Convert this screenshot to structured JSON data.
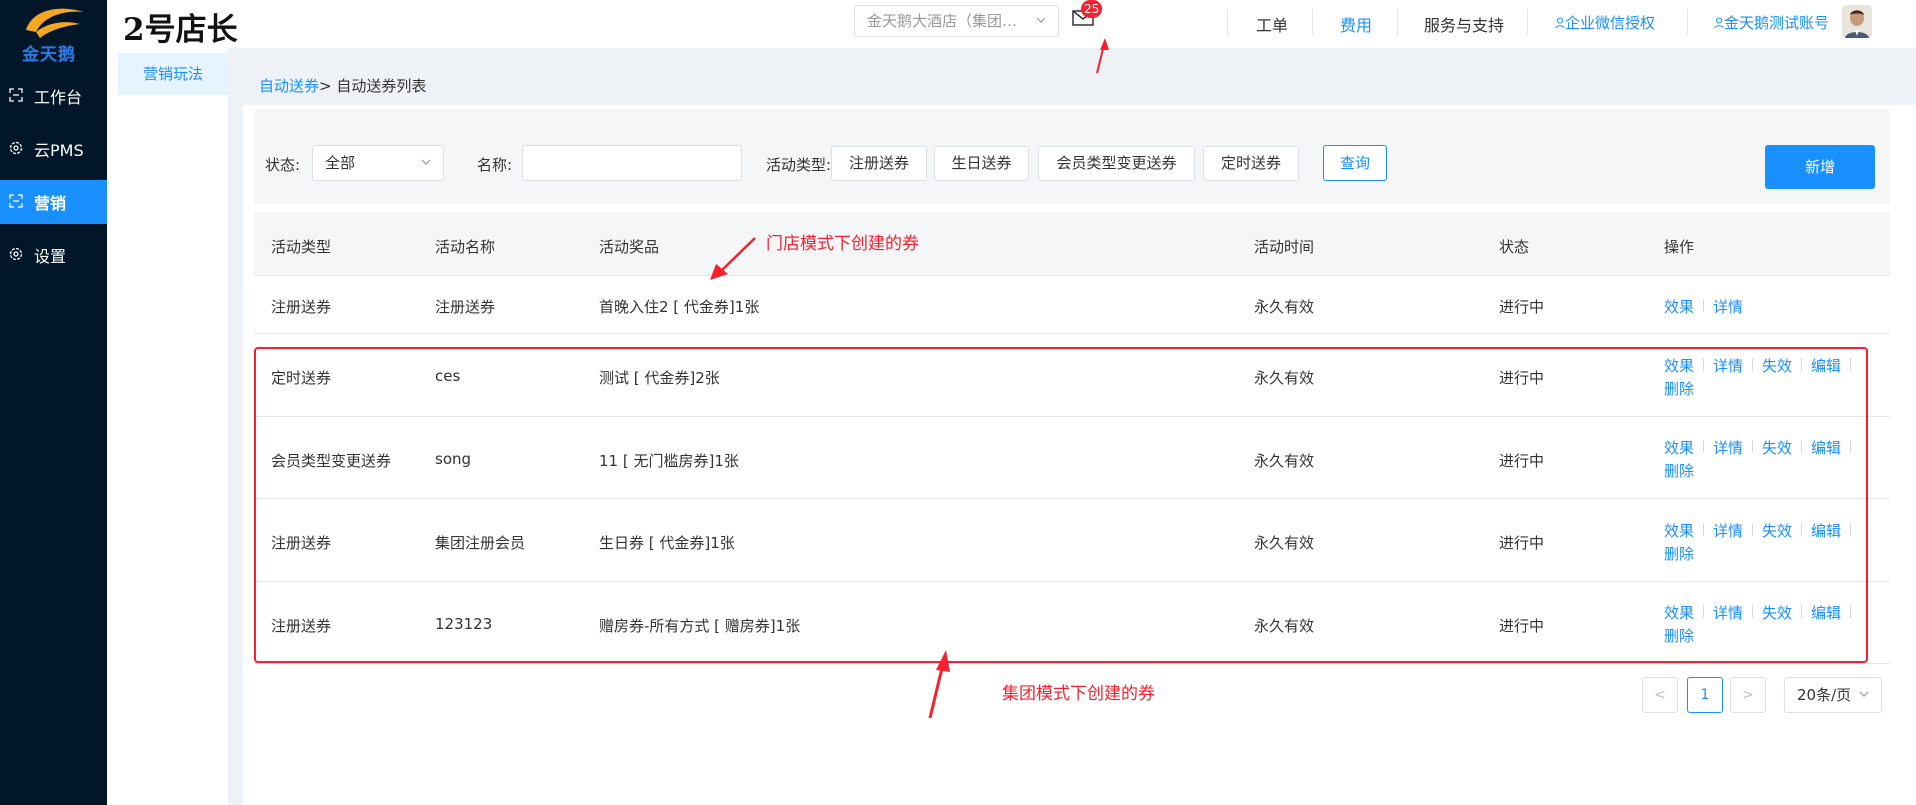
{
  "brand": {
    "logo_text": "金天鹅",
    "app_title": "2号店长"
  },
  "nav": {
    "items": [
      {
        "label": "工作台",
        "icon": "workbench-icon"
      },
      {
        "label": "云PMS",
        "icon": "gear-icon"
      },
      {
        "label": "营销",
        "icon": "marketing-icon"
      },
      {
        "label": "设置",
        "icon": "gear-icon"
      }
    ],
    "active_color": "#1890ff"
  },
  "header": {
    "store_select_value": "金天鹅大酒店（集团…",
    "mail_badge": "25",
    "work_order": "工单",
    "fees": "费用",
    "service_support": "服务与支持",
    "wechat_auth": "企业微信授权",
    "account": "金天鹅测试账号"
  },
  "subnav": {
    "item": "营销玩法"
  },
  "breadcrumb": {
    "parent": "自动送券",
    "current": "> 自动送券列表"
  },
  "filters": {
    "status_label": "状态:",
    "status_value": "全部",
    "name_label": "名称:",
    "name_value": "",
    "type_label": "活动类型:",
    "type_options": [
      "注册送券",
      "生日送券",
      "会员类型变更送券",
      "定时送券"
    ],
    "query_button": "查询",
    "add_button": "新增"
  },
  "table": {
    "headers": [
      "活动类型",
      "活动名称",
      "活动奖品",
      "活动时间",
      "状态",
      "操作"
    ],
    "rows": [
      {
        "type": "注册送券",
        "name": "注册送券",
        "prize": "首晚入住2 [ 代金券]1张",
        "time": "永久有效",
        "status": "进行中",
        "actions": [
          "效果",
          "详情"
        ]
      },
      {
        "type": "定时送券",
        "name": "ces",
        "prize": "测试 [ 代金券]2张",
        "time": "永久有效",
        "status": "进行中",
        "actions": [
          "效果",
          "详情",
          "失效",
          "编辑",
          "删除"
        ]
      },
      {
        "type": "会员类型变更送券",
        "name": "song",
        "prize": "11 [ 无门槛房券]1张",
        "time": "永久有效",
        "status": "进行中",
        "actions": [
          "效果",
          "详情",
          "失效",
          "编辑",
          "删除"
        ]
      },
      {
        "type": "注册送券",
        "name": "集团注册会员",
        "prize": "生日券 [ 代金券]1张",
        "time": "永久有效",
        "status": "进行中",
        "actions": [
          "效果",
          "详情",
          "失效",
          "编辑",
          "删除"
        ]
      },
      {
        "type": "注册送券",
        "name": "123123",
        "prize": "赠房券-所有方式 [ 赠房券]1张",
        "time": "永久有效",
        "status": "进行中",
        "actions": [
          "效果",
          "详情",
          "失效",
          "编辑",
          "删除"
        ]
      }
    ]
  },
  "pagination": {
    "prev": "<",
    "current": "1",
    "next": ">",
    "page_size": "20条/页"
  },
  "annotations": {
    "store_mode": "门店模式下创建的券",
    "group_mode": "集团模式下创建的券",
    "color": "#f5222d"
  }
}
